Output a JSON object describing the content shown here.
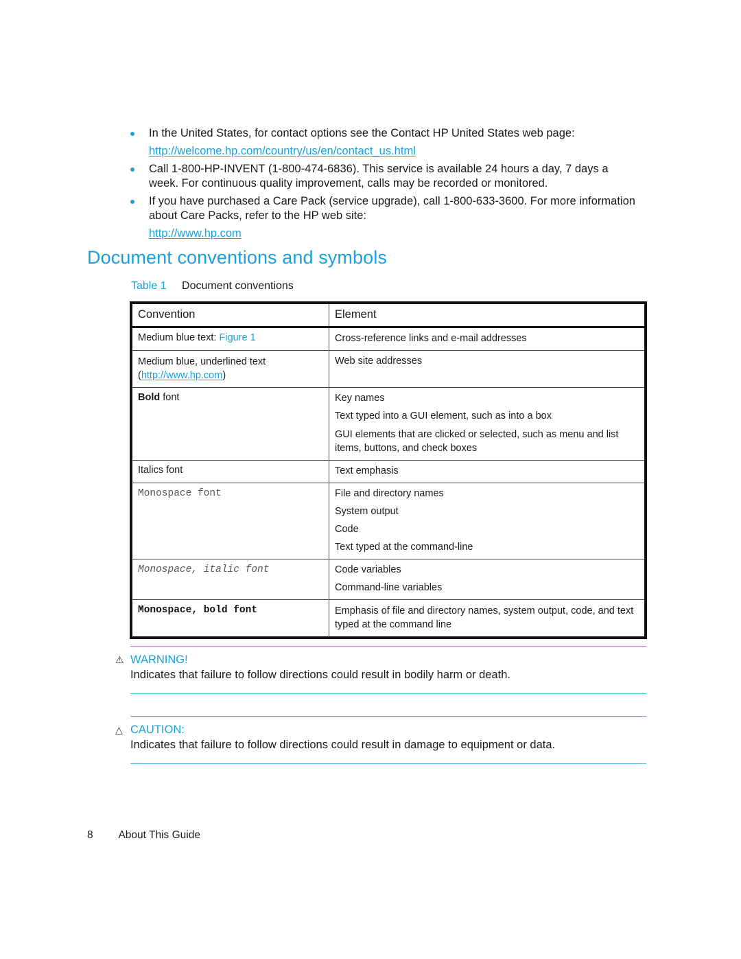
{
  "bullets": [
    {
      "text": "In the United States, for contact options see the Contact HP United States web page:",
      "link": "http://welcome.hp.com/country/us/en/contact_us.html"
    },
    {
      "text": "Call 1-800-HP-INVENT (1-800-474-6836). This service is available 24 hours a day, 7 days a week. For continuous quality improvement, calls may be recorded or monitored."
    },
    {
      "text": "If you have purchased a Care Pack (service upgrade), call 1-800-633-3600. For more information about Care Packs, refer to the HP web site:",
      "link": "http://www.hp.com"
    }
  ],
  "section": {
    "title": "Document conventions and symbols"
  },
  "table": {
    "caption_number": "Table 1",
    "caption_title": "Document conventions",
    "headers": [
      "Convention",
      "Element"
    ],
    "rows": [
      {
        "convention_prefix": "Medium blue text: ",
        "convention_link": "Figure 1",
        "elements": [
          "Cross-reference links and e-mail addresses"
        ]
      },
      {
        "convention_prefix": "Medium blue, underlined text",
        "convention_link": "http://www.hp.com",
        "elements": [
          "Web site addresses"
        ]
      },
      {
        "convention_bold": "Bold",
        "convention_suffix": " font",
        "elements": [
          "Key names",
          "Text typed into a GUI element, such as into a box",
          "GUI elements that are clicked or selected, such as menu and list items, buttons, and check boxes"
        ]
      },
      {
        "convention": "Italics font",
        "elements": [
          "Text emphasis"
        ]
      },
      {
        "convention": "Monospace font",
        "elements": [
          "File and directory names",
          "System output",
          "Code",
          "Text typed at the command-line"
        ]
      },
      {
        "convention": "Monospace, italic font",
        "elements": [
          "Code variables",
          "Command-line variables"
        ]
      },
      {
        "convention": "Monospace, bold font",
        "elements": [
          "Emphasis of file and directory names, system output, code, and text typed at the command line"
        ]
      }
    ]
  },
  "warning": {
    "icon": "warning-triangle-icon",
    "label": "WARNING!",
    "text": "Indicates that failure to follow directions could result in bodily harm or death."
  },
  "caution": {
    "icon": "caution-triangle-icon",
    "label": "CAUTION:",
    "text": "Indicates that failure to follow directions could result in damage to equipment or data."
  },
  "footer": {
    "page_number": "8",
    "chapter": "About This Guide"
  },
  "colors": {
    "accent": "#1aa0db",
    "rule": "#4fb9e3",
    "text": "#1a1a1a"
  }
}
